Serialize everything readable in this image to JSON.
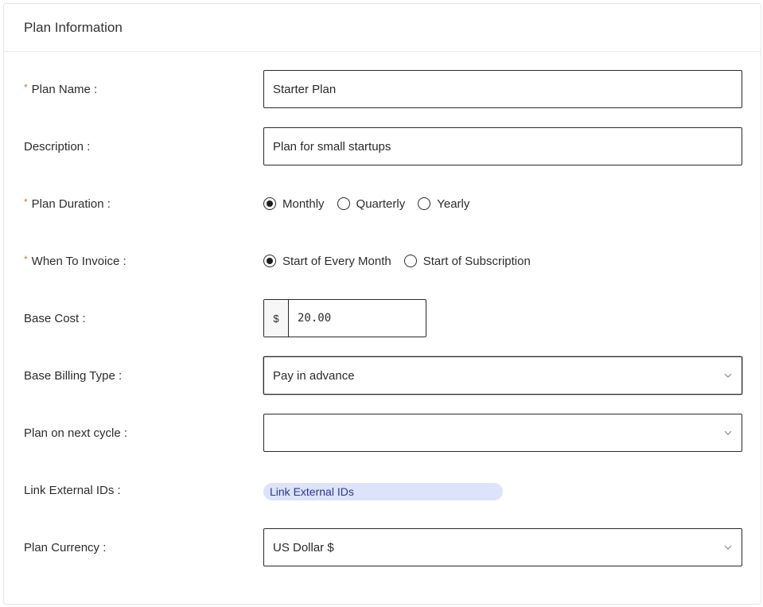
{
  "card": {
    "title": "Plan Information"
  },
  "fields": {
    "plan_name": {
      "label": "Plan Name :",
      "required": "*",
      "value": "Starter Plan"
    },
    "description": {
      "label": "Description :",
      "value": "Plan for small startups"
    },
    "plan_duration": {
      "label": "Plan Duration :",
      "required": "*",
      "options": [
        "Monthly",
        "Quarterly",
        "Yearly"
      ],
      "selected": "Monthly"
    },
    "when_to_invoice": {
      "label": "When To Invoice :",
      "required": "*",
      "options": [
        "Start of Every Month",
        "Start of Subscription"
      ],
      "selected": "Start of Every Month"
    },
    "base_cost": {
      "label": "Base Cost :",
      "prefix": "$",
      "value": "20.00"
    },
    "base_billing_type": {
      "label": "Base Billing Type :",
      "value": "Pay in advance"
    },
    "plan_next_cycle": {
      "label": "Plan on next cycle :",
      "value": ""
    },
    "link_external_ids": {
      "label": "Link External IDs :",
      "button": "Link External IDs"
    },
    "plan_currency": {
      "label": "Plan Currency :",
      "value": "US Dollar $"
    }
  },
  "icons": {
    "dropdown": "chevron-down-icon"
  },
  "colors": {
    "required": "#d77a2c",
    "link_pill_bg": "#dde3fb",
    "link_pill_text": "#2a3a8a"
  }
}
